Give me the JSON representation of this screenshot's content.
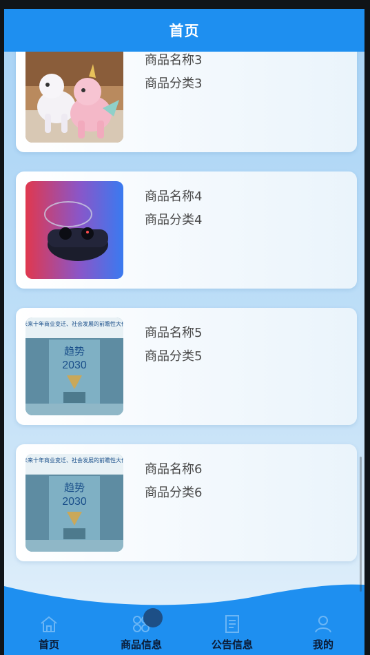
{
  "header": {
    "title": "首页"
  },
  "products": [
    {
      "name": "商品名称3",
      "category": "商品分类3",
      "image": "unicorn-plush-toy-image"
    },
    {
      "name": "商品名称4",
      "category": "商品分类4",
      "image": "wireless-earbuds-case-image"
    },
    {
      "name": "商品名称5",
      "category": "商品分类5",
      "image": "trend-2030-book-cover-image"
    },
    {
      "name": "商品名称6",
      "category": "商品分类6",
      "image": "trend-2030-book-cover-image"
    }
  ],
  "book_cover": {
    "tagline": "未来十年商业变迁、社会发展的前瞻性大作",
    "title": "趋势",
    "year": "2030"
  },
  "tabbar": {
    "items": [
      {
        "label": "首页",
        "icon": "home-icon"
      },
      {
        "label": "商品信息",
        "icon": "grid-icon"
      },
      {
        "label": "公告信息",
        "icon": "notice-icon"
      },
      {
        "label": "我的",
        "icon": "user-icon"
      }
    ]
  },
  "colors": {
    "primary": "#1e8ff0",
    "card_text": "#4a4a4a",
    "tab_text": "#0b1a33"
  }
}
